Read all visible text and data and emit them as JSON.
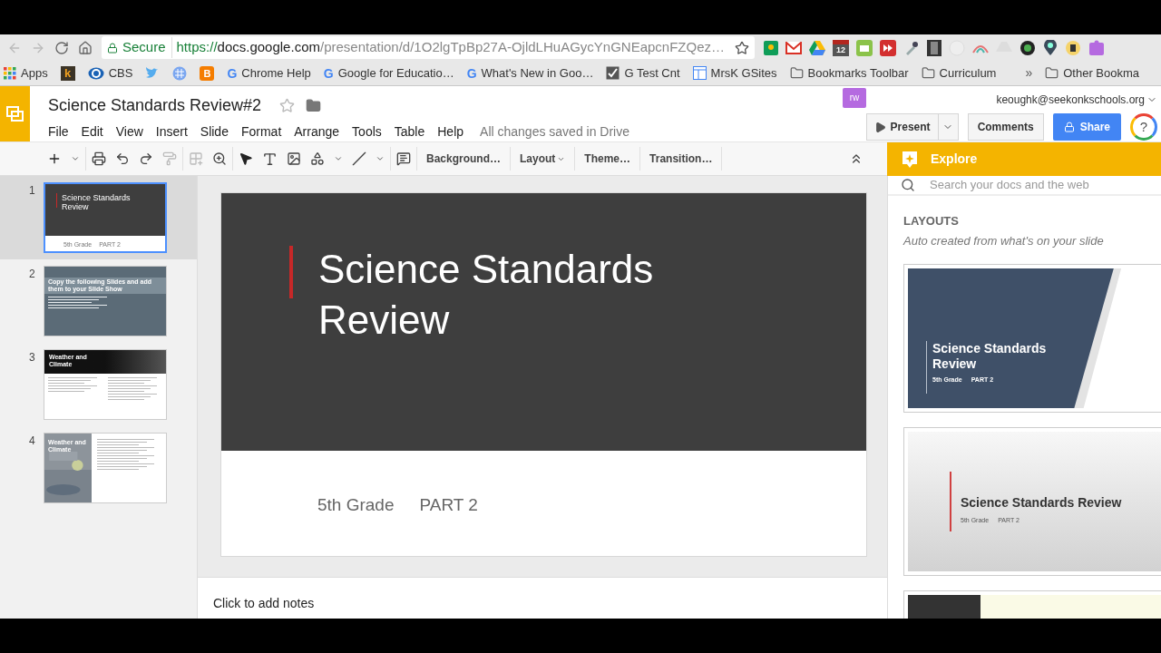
{
  "browser": {
    "secure_label": "Secure",
    "url_scheme": "https://",
    "url_host": "docs.google.com",
    "url_rest": "/presentation/d/1O2lgTpBp27A-OjldLHuAGycYnGNEapcnFZQez…",
    "calendar_day": "12"
  },
  "bookmarks": [
    {
      "kind": "apps",
      "label": "Apps"
    },
    {
      "kind": "letter",
      "glyph": "k"
    },
    {
      "kind": "eye",
      "label": "CBS"
    },
    {
      "kind": "bird"
    },
    {
      "kind": "grid"
    },
    {
      "kind": "blog",
      "glyph": "B"
    },
    {
      "kind": "google",
      "glyph": "G",
      "label": "Chrome Help"
    },
    {
      "kind": "google",
      "glyph": "G",
      "label": "Google for Educatio…"
    },
    {
      "kind": "google",
      "glyph": "G",
      "label": "What's New in Goo…"
    },
    {
      "kind": "check",
      "label": "G Test Cnt"
    },
    {
      "kind": "site",
      "label": "MrsK GSites"
    },
    {
      "kind": "folder",
      "label": "Bookmarks Toolbar"
    },
    {
      "kind": "folder",
      "label": "Curriculum"
    }
  ],
  "bookmarks_more": "»",
  "other_bookmarks": "Other Bookma",
  "doc": {
    "title": "Science Standards Review#2",
    "save_status": "All changes saved in Drive",
    "account": "keoughk@seekonkschools.org",
    "extension_glyph": "rw"
  },
  "menu": [
    "File",
    "Edit",
    "View",
    "Insert",
    "Slide",
    "Format",
    "Arrange",
    "Tools",
    "Table",
    "Help"
  ],
  "header_buttons": {
    "present": "Present",
    "comments": "Comments",
    "share": "Share",
    "help_glyph": "?"
  },
  "toolbar_text_buttons": [
    {
      "label": "Background…",
      "dropdown": false
    },
    {
      "label": "Layout",
      "dropdown": true
    },
    {
      "label": "Theme…",
      "dropdown": false
    },
    {
      "label": "Transition…",
      "dropdown": false
    }
  ],
  "slides": [
    {
      "number": "1",
      "selected": true,
      "kind": "title",
      "title": "Science Standards Review",
      "grade": "5th Grade",
      "part": "PART 2"
    },
    {
      "number": "2",
      "selected": false,
      "kind": "instructions",
      "title": "Copy the following Slides and add them to your Slide Show"
    },
    {
      "number": "3",
      "selected": false,
      "kind": "banner",
      "title": "Weather and Climate"
    },
    {
      "number": "4",
      "selected": false,
      "title": "Weather and Climate"
    }
  ],
  "current_slide": {
    "title": "Science Standards Review",
    "grade": "5th Grade",
    "part": "PART 2"
  },
  "notes_placeholder": "Click to add notes",
  "explore": {
    "title": "Explore",
    "search_placeholder": "Search your docs and the web",
    "section": "LAYOUTS",
    "subtitle": "Auto created from what's on your slide",
    "layouts": [
      {
        "kind": "angled",
        "title": "Science Standards Review",
        "grade": "5th Grade",
        "part": "PART 2"
      },
      {
        "kind": "light",
        "title": "Science Standards Review",
        "grade": "5th Grade",
        "part": "PART 2"
      }
    ]
  }
}
